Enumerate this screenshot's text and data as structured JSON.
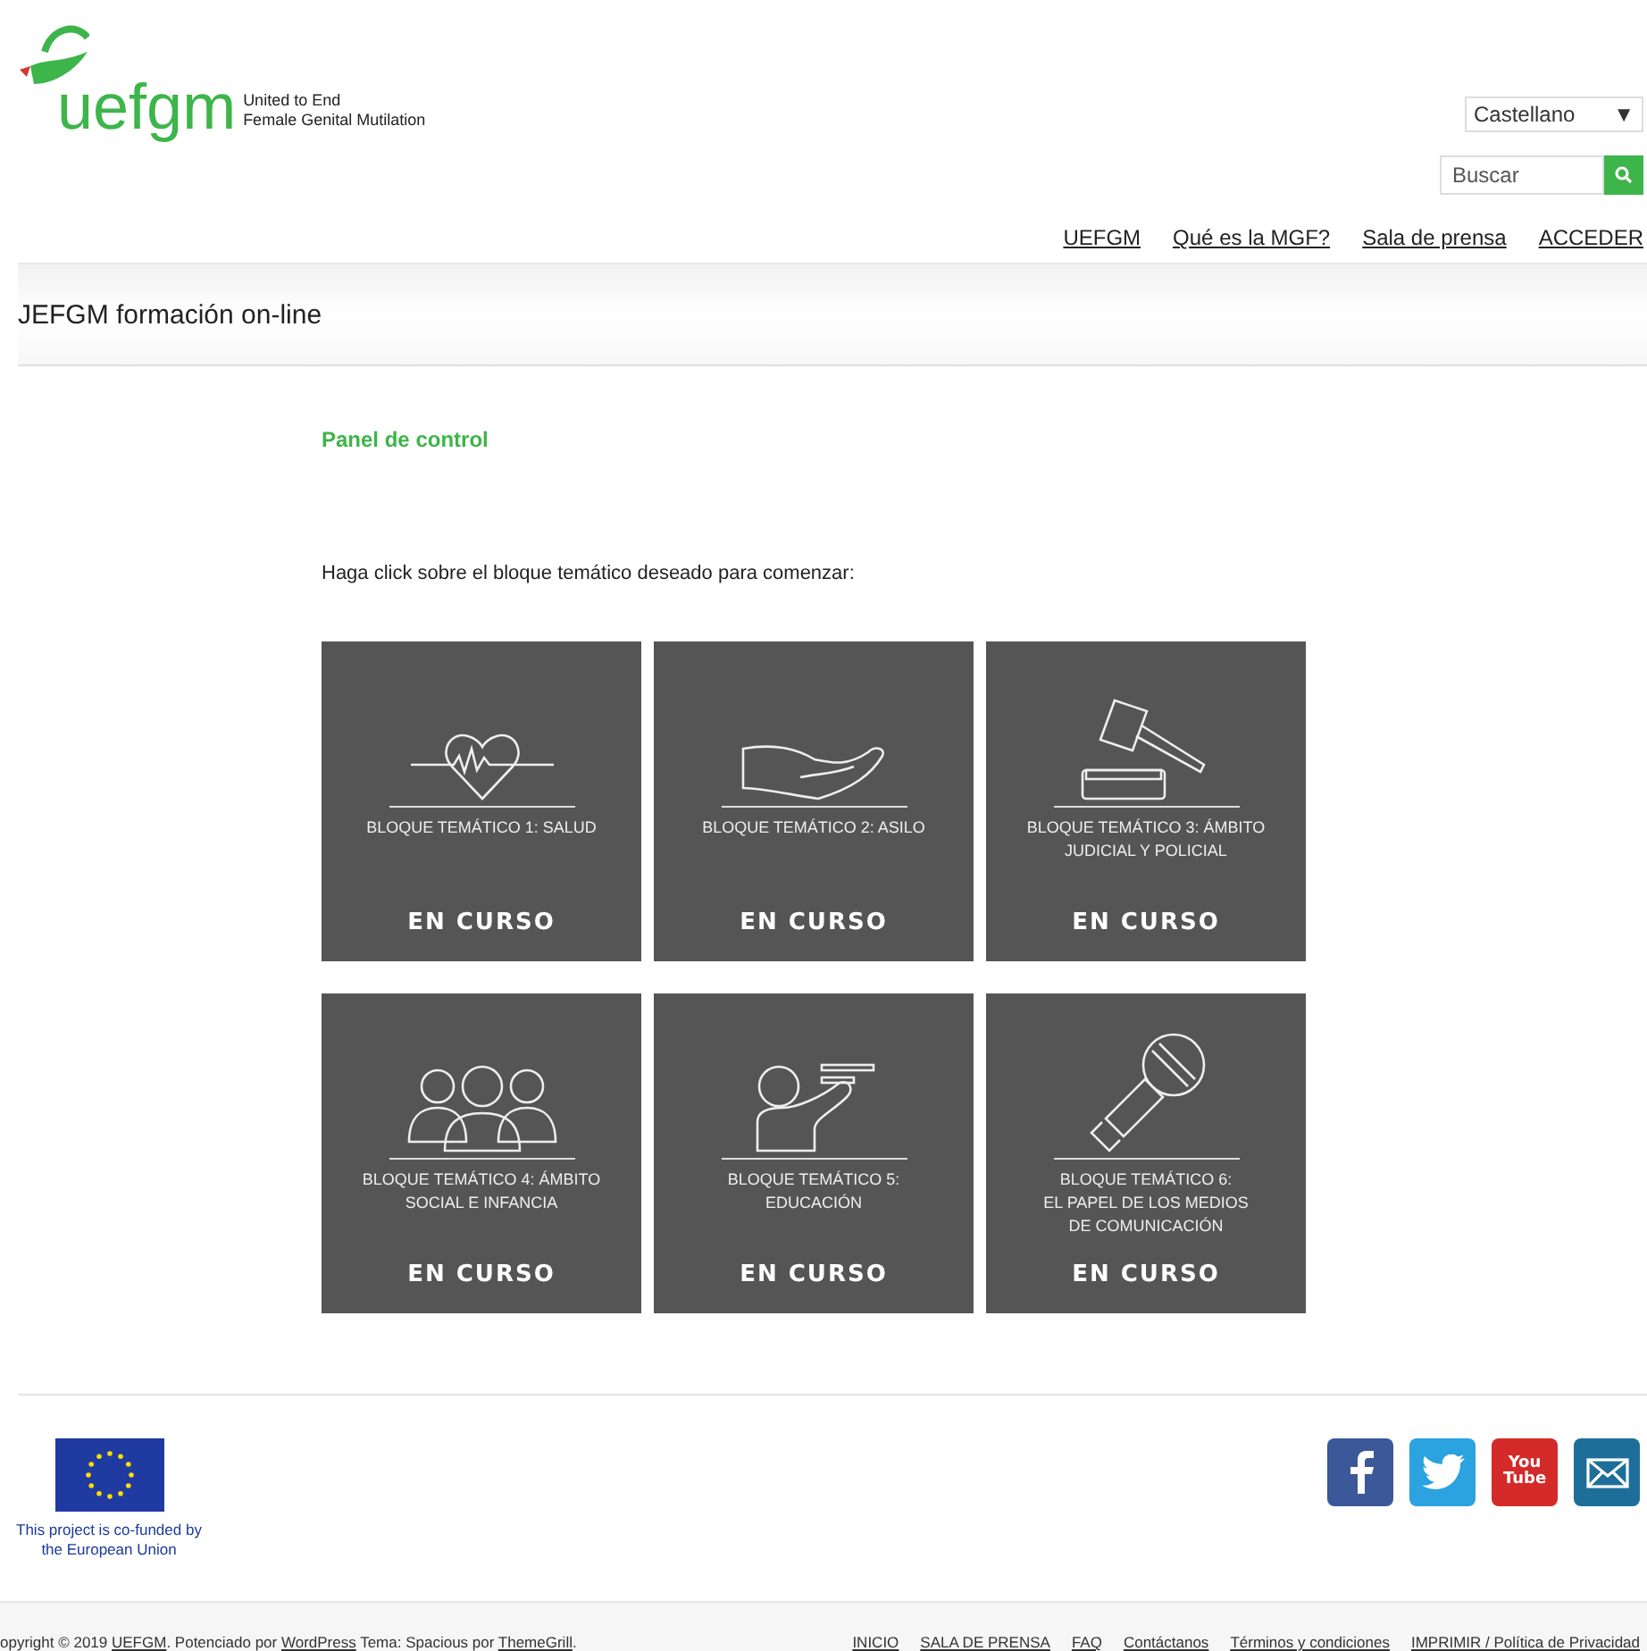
{
  "logo": {
    "wordmark": "uefgm",
    "tagline": [
      "United to End",
      "Female Genital Mutilation"
    ]
  },
  "language": {
    "value": "Castellano",
    "arrow": "▼"
  },
  "search": {
    "placeholder": "Buscar"
  },
  "nav": [
    "UEFGM",
    "Qué es la MGF?",
    "Sala de prensa",
    "ACCEDER"
  ],
  "page_title": "JEFGM formación on-line",
  "heading": "Panel de control",
  "instruction": "Haga click sobre el bloque temático deseado para comenzar:",
  "blocks": [
    {
      "kind": "heart",
      "title": [
        "BLOQUE TEMÁTICO 1: SALUD"
      ],
      "status": "EN CURSO"
    },
    {
      "kind": "hand",
      "title": [
        "BLOQUE TEMÁTICO 2: ASILO"
      ],
      "status": "EN CURSO"
    },
    {
      "kind": "gavel",
      "title": [
        "BLOQUE TEMÁTICO 3: ÁMBITO",
        "JUDICIAL Y POLICIAL"
      ],
      "status": "EN CURSO"
    },
    {
      "kind": "people",
      "title": [
        "BLOQUE TEMÁTICO 4: ÁMBITO",
        "SOCIAL E INFANCIA"
      ],
      "status": "EN CURSO"
    },
    {
      "kind": "teacher",
      "title": [
        "BLOQUE TEMÁTICO 5:",
        "EDUCACIÓN"
      ],
      "status": "EN CURSO"
    },
    {
      "kind": "microphone",
      "title": [
        "BLOQUE TEMÁTICO 6:",
        "EL PAPEL DE LOS MEDIOS",
        "DE COMUNICACIÓN"
      ],
      "status": "EN CURSO"
    }
  ],
  "eu_note": "This project is co-funded by the European Union",
  "social": [
    {
      "kind": "facebook"
    },
    {
      "kind": "twitter"
    },
    {
      "kind": "youtube",
      "label": [
        "You",
        "Tube"
      ]
    },
    {
      "kind": "email"
    }
  ],
  "copyright": [
    {
      "kind": "text",
      "text": "opyright © 2019 "
    },
    {
      "kind": "link",
      "text": "UEFGM"
    },
    {
      "kind": "text",
      "text": ". Potenciado por "
    },
    {
      "kind": "link",
      "text": "WordPress"
    },
    {
      "kind": "text",
      "text": " Tema: Spacious por "
    },
    {
      "kind": "link",
      "text": "ThemeGrill"
    },
    {
      "kind": "text",
      "text": "."
    }
  ],
  "footer_links": [
    "INICIO",
    "SALA DE PRENSA",
    "FAQ",
    "Contáctanos",
    "Términos y condiciones",
    "IMPRIMIR / Política de Privacidad"
  ]
}
